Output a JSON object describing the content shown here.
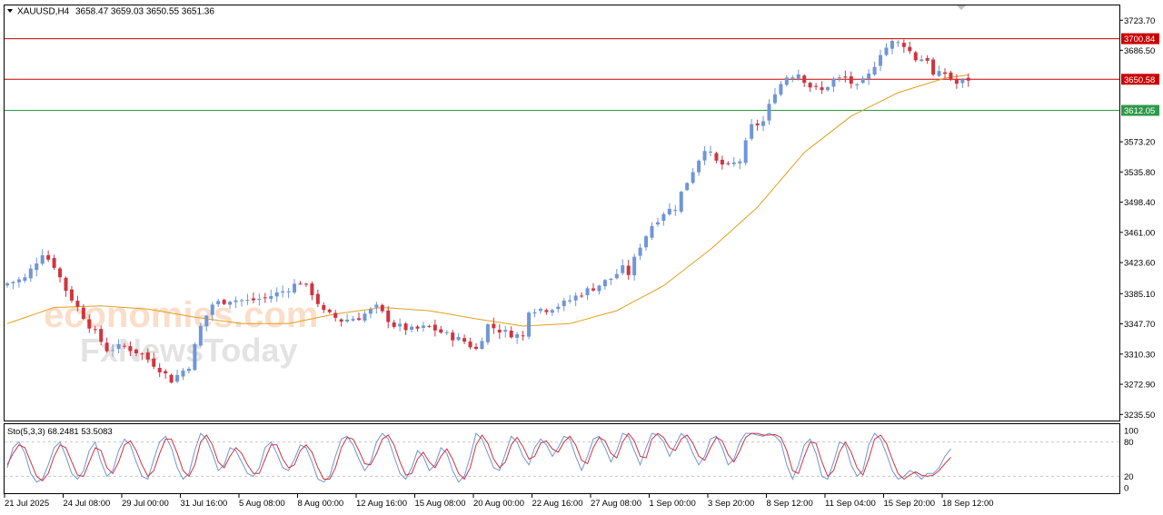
{
  "header": {
    "symbol": "XAUUSD,H4",
    "ohlc": "3658.47 3659.03 3650.55 3651.36"
  },
  "indicator": {
    "label": "Sto(5,3,3) 68.2481 53.5083",
    "levels": [
      "100",
      "80",
      "20",
      "0"
    ]
  },
  "watermark": {
    "line1": "economies.com",
    "line2": "FxNewsToday"
  },
  "colors": {
    "bull": "#6f96d6",
    "bear": "#d0343f",
    "ma": "#e0a020",
    "resistance": "#cc0000",
    "support": "#2e9a4a",
    "stoch_main": "#6f96d6",
    "stoch_signal": "#d0343f",
    "grid": "#c8c8c8"
  },
  "chart_data": {
    "type": "candlestick",
    "price_ticks": [
      3723.7,
      3686.5,
      3573.2,
      3535.8,
      3498.4,
      3461.0,
      3423.6,
      3385.1,
      3347.7,
      3310.3,
      3272.9,
      3235.5
    ],
    "price_tick_labels": [
      "3723.70",
      "3686.50",
      "3573.20",
      "3535.80",
      "3498.40",
      "3461.00",
      "3423.60",
      "3385.10",
      "3347.70",
      "3310.30",
      "3272.90",
      "3235.50"
    ],
    "ylim": [
      3228,
      3742
    ],
    "levels": [
      {
        "label": "3700.84",
        "value": 3700.84,
        "kind": "resistance"
      },
      {
        "label": "3650.58",
        "value": 3650.58,
        "kind": "resistance"
      },
      {
        "label": "3612.05",
        "value": 3612.05,
        "kind": "support"
      }
    ],
    "x_labels": [
      "21 Jul 2025",
      "24 Jul 08:00",
      "29 Jul 00:00",
      "31 Jul 16:00",
      "5 Aug 08:00",
      "8 Aug 00:00",
      "12 Aug 16:00",
      "15 Aug 08:00",
      "20 Aug 00:00",
      "22 Aug 16:00",
      "27 Aug 08:00",
      "1 Sep 00:00",
      "3 Sep 20:00",
      "8 Sep 12:00",
      "11 Sep 04:00",
      "15 Sep 20:00",
      "18 Sep 12:00"
    ],
    "x_label_index": [
      0,
      10,
      20,
      30,
      40,
      50,
      60,
      70,
      80,
      90,
      100,
      110,
      120,
      130,
      140,
      150,
      160
    ],
    "price_path": [
      [
        0,
        3398
      ],
      [
        3,
        3404
      ],
      [
        6,
        3436
      ],
      [
        8,
        3420
      ],
      [
        10,
        3390
      ],
      [
        12,
        3368
      ],
      [
        14,
        3346
      ],
      [
        17,
        3316
      ],
      [
        20,
        3320
      ],
      [
        23,
        3310
      ],
      [
        26,
        3292
      ],
      [
        28,
        3278
      ],
      [
        31,
        3296
      ],
      [
        33,
        3344
      ],
      [
        35,
        3372
      ],
      [
        38,
        3378
      ],
      [
        41,
        3376
      ],
      [
        44,
        3380
      ],
      [
        47,
        3388
      ],
      [
        50,
        3400
      ],
      [
        52,
        3386
      ],
      [
        54,
        3362
      ],
      [
        57,
        3352
      ],
      [
        60,
        3356
      ],
      [
        63,
        3368
      ],
      [
        66,
        3346
      ],
      [
        69,
        3340
      ],
      [
        72,
        3344
      ],
      [
        75,
        3334
      ],
      [
        78,
        3326
      ],
      [
        80,
        3316
      ],
      [
        82,
        3346
      ],
      [
        85,
        3337
      ],
      [
        88,
        3332
      ],
      [
        89,
        3366
      ],
      [
        92,
        3366
      ],
      [
        95,
        3373
      ],
      [
        98,
        3386
      ],
      [
        101,
        3396
      ],
      [
        103,
        3404
      ],
      [
        105,
        3416
      ],
      [
        106,
        3410
      ],
      [
        108,
        3445
      ],
      [
        110,
        3470
      ],
      [
        112,
        3486
      ],
      [
        114,
        3492
      ],
      [
        115,
        3510
      ],
      [
        117,
        3538
      ],
      [
        119,
        3566
      ],
      [
        121,
        3548
      ],
      [
        123,
        3542
      ],
      [
        125,
        3550
      ],
      [
        127,
        3592
      ],
      [
        129,
        3598
      ],
      [
        131,
        3636
      ],
      [
        133,
        3654
      ],
      [
        135,
        3658
      ],
      [
        137,
        3642
      ],
      [
        139,
        3636
      ],
      [
        141,
        3650
      ],
      [
        143,
        3652
      ],
      [
        145,
        3640
      ],
      [
        147,
        3655
      ],
      [
        149,
        3684
      ],
      [
        151,
        3696
      ],
      [
        153,
        3694
      ],
      [
        155,
        3676
      ],
      [
        157,
        3676
      ],
      [
        158,
        3655
      ],
      [
        160,
        3658
      ],
      [
        162,
        3645
      ],
      [
        164,
        3651
      ]
    ],
    "ma_path": [
      [
        0,
        3348
      ],
      [
        8,
        3368
      ],
      [
        16,
        3370
      ],
      [
        24,
        3366
      ],
      [
        32,
        3356
      ],
      [
        40,
        3348
      ],
      [
        48,
        3348
      ],
      [
        56,
        3360
      ],
      [
        64,
        3368
      ],
      [
        72,
        3364
      ],
      [
        80,
        3354
      ],
      [
        88,
        3345
      ],
      [
        96,
        3348
      ],
      [
        104,
        3364
      ],
      [
        112,
        3395
      ],
      [
        120,
        3440
      ],
      [
        128,
        3492
      ],
      [
        136,
        3560
      ],
      [
        144,
        3605
      ],
      [
        152,
        3634
      ],
      [
        160,
        3652
      ],
      [
        164,
        3656
      ]
    ],
    "stoch_main": [
      35,
      70,
      80,
      60,
      25,
      10,
      15,
      40,
      70,
      80,
      55,
      25,
      15,
      30,
      65,
      80,
      45,
      20,
      30,
      65,
      85,
      75,
      45,
      20,
      15,
      50,
      80,
      90,
      70,
      35,
      15,
      25,
      65,
      95,
      85,
      60,
      30,
      40,
      70,
      65,
      45,
      25,
      20,
      35,
      70,
      80,
      60,
      35,
      30,
      50,
      75,
      70,
      45,
      15,
      10,
      20,
      55,
      85,
      90,
      75,
      50,
      30,
      45,
      80,
      95,
      85,
      55,
      25,
      15,
      35,
      65,
      55,
      30,
      40,
      70,
      60,
      30,
      10,
      20,
      55,
      95,
      85,
      60,
      35,
      30,
      60,
      90,
      80,
      55,
      40,
      70,
      85,
      75,
      55,
      70,
      90,
      85,
      55,
      30,
      55,
      85,
      90,
      70,
      45,
      65,
      95,
      90,
      65,
      40,
      70,
      95,
      92,
      80,
      55,
      75,
      95,
      85,
      60,
      40,
      55,
      85,
      90,
      70,
      40,
      50,
      80,
      95,
      95,
      92,
      90,
      95,
      90,
      80,
      40,
      15,
      40,
      75,
      85,
      60,
      20,
      15,
      45,
      80,
      75,
      40,
      20,
      30,
      75,
      95,
      85,
      60,
      30,
      15,
      20,
      30,
      25,
      15,
      25,
      25,
      35,
      55,
      68
    ],
    "stoch_signal": [
      40,
      60,
      75,
      70,
      45,
      20,
      12,
      25,
      55,
      75,
      70,
      45,
      22,
      20,
      45,
      70,
      65,
      35,
      25,
      45,
      75,
      82,
      65,
      40,
      20,
      30,
      60,
      85,
      85,
      60,
      30,
      20,
      40,
      80,
      92,
      75,
      45,
      35,
      55,
      70,
      60,
      40,
      25,
      25,
      50,
      75,
      75,
      50,
      35,
      40,
      65,
      75,
      62,
      35,
      15,
      15,
      35,
      70,
      88,
      85,
      65,
      42,
      40,
      60,
      85,
      92,
      75,
      45,
      22,
      25,
      50,
      62,
      45,
      35,
      55,
      68,
      50,
      25,
      15,
      35,
      75,
      92,
      78,
      50,
      35,
      45,
      75,
      88,
      72,
      50,
      55,
      78,
      82,
      68,
      62,
      80,
      90,
      75,
      48,
      42,
      70,
      88,
      82,
      60,
      52,
      80,
      95,
      82,
      55,
      52,
      85,
      95,
      88,
      70,
      65,
      85,
      92,
      78,
      55,
      48,
      70,
      88,
      82,
      58,
      45,
      65,
      88,
      95,
      95,
      92,
      92,
      93,
      88,
      65,
      30,
      25,
      55,
      80,
      78,
      45,
      20,
      30,
      62,
      80,
      62,
      35,
      22,
      50,
      85,
      92,
      78,
      50,
      25,
      15,
      22,
      28,
      22,
      20,
      22,
      30,
      42,
      53.5
    ]
  }
}
